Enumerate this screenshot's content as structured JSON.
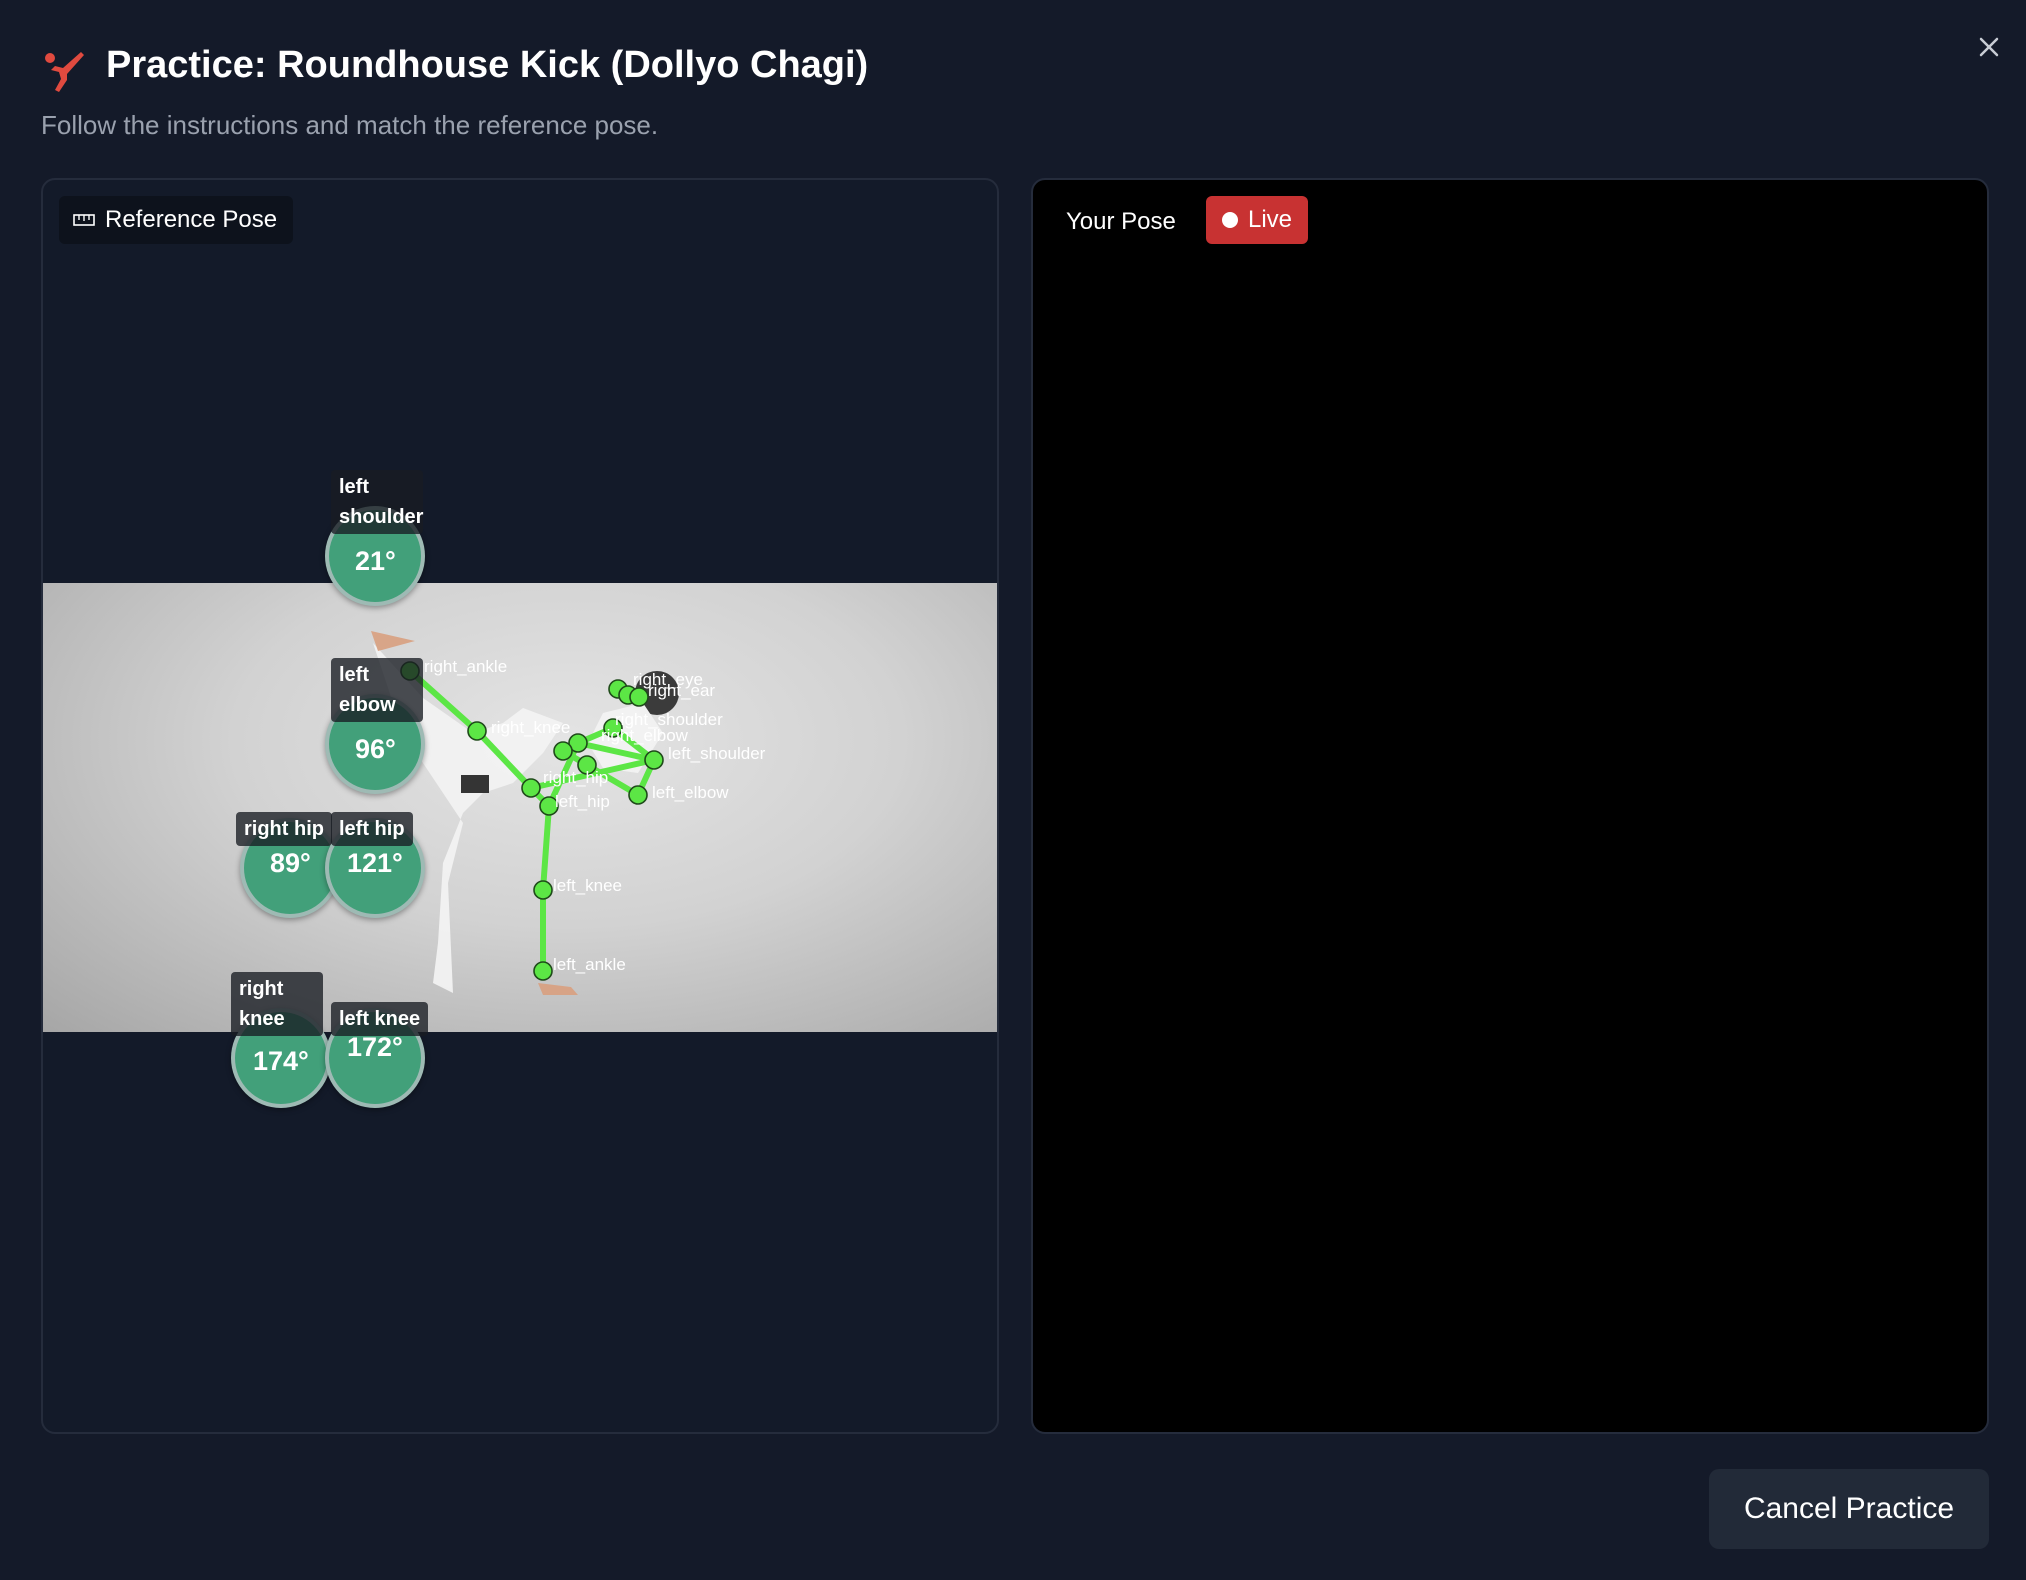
{
  "header": {
    "icon": "kick-icon",
    "title": "Practice: Roundhouse Kick (Dollyo Chagi)",
    "subtitle": "Follow the instructions and match the reference pose."
  },
  "reference_panel": {
    "badge_icon": "ruler-icon",
    "badge_label": "Reference Pose",
    "keypoint_labels": {
      "right_ankle": "right_ankle",
      "right_knee": "right_knee",
      "right_eye": "right_eye",
      "right_ear": "right_ear",
      "right_shoulder": "right_shoulder",
      "right_elbow": "right_elbow",
      "left_shoulder": "left_shoulder",
      "left_elbow": "left_elbow",
      "right_hip": "right_hip",
      "left_hip": "left_hip",
      "left_knee": "left_knee",
      "left_ankle": "left_ankle"
    },
    "angles": [
      {
        "label": "left shoulder",
        "value": "21°"
      },
      {
        "label": "left elbow",
        "value": "96°"
      },
      {
        "label": "right hip",
        "value": "89°"
      },
      {
        "label": "left hip",
        "value": "121°"
      },
      {
        "label": "right knee",
        "value": "174°"
      },
      {
        "label": "left knee",
        "value": "172°"
      }
    ],
    "skeleton_color": "#5ce645",
    "gauge_color": "#42a07a"
  },
  "your_pose_panel": {
    "label": "Your Pose",
    "live_label": "Live",
    "live_color": "#c83232"
  },
  "actions": {
    "cancel_label": "Cancel Practice"
  },
  "accent_color": "#e04a3f"
}
